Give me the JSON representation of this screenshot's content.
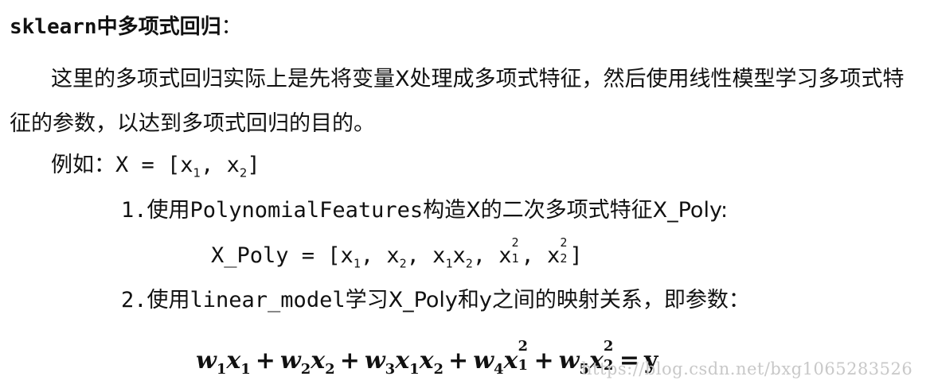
{
  "title": {
    "code": "sklearn",
    "text": "中多项式回归",
    "colon": "："
  },
  "paragraph": "这里的多项式回归实际上是先将变量X处理成多项式特征，然后使用线性模型学习多项式特征的参数，以达到多项式回归的目的。",
  "example": {
    "prefix": "例如：",
    "expr_start": "X = [x",
    "sub1": "1",
    "mid": ", x",
    "sub2": "2",
    "end": "]"
  },
  "step1": {
    "num": "1.",
    "pre": "使用",
    "code": "PolynomialFeatures",
    "post": "构造X的二次多项式特征X_Poly:"
  },
  "poly": {
    "start": "X_Poly = [x",
    "s1": "1",
    "t2": ", x",
    "s2": "2",
    "t3": ", x",
    "s3": "1",
    "t3b": "x",
    "s3b": "2",
    "t4": ", x",
    "p4": "2",
    "s4": "1",
    "t5": ", x",
    "p5": "2",
    "s5": "2",
    "end": "]"
  },
  "step2": {
    "num": "2.",
    "pre": "使用",
    "code": "linear_model",
    "post": "学习X_Poly和y之间的映射关系，即参数："
  },
  "formula": {
    "w1": "w",
    "w1s": "1",
    "x1": "x",
    "x1s": "1",
    "plus1": "+",
    "w2": "w",
    "w2s": "2",
    "x2": "x",
    "x2s": "2",
    "plus2": "+",
    "w3": "w",
    "w3s": "3",
    "x3a": "x",
    "x3as": "1",
    "x3b": "x",
    "x3bs": "2",
    "plus3": "+",
    "w4": "w",
    "w4s": "4",
    "x4": "x",
    "x4p": "2",
    "x4s": "1",
    "plus4": "+",
    "w5": "w",
    "w5s": "5",
    "x5": "x",
    "x5p": "2",
    "x5s": "2",
    "eq": "=",
    "y": "y"
  },
  "watermark": "https://blog.csdn.net/bxg1065283526"
}
